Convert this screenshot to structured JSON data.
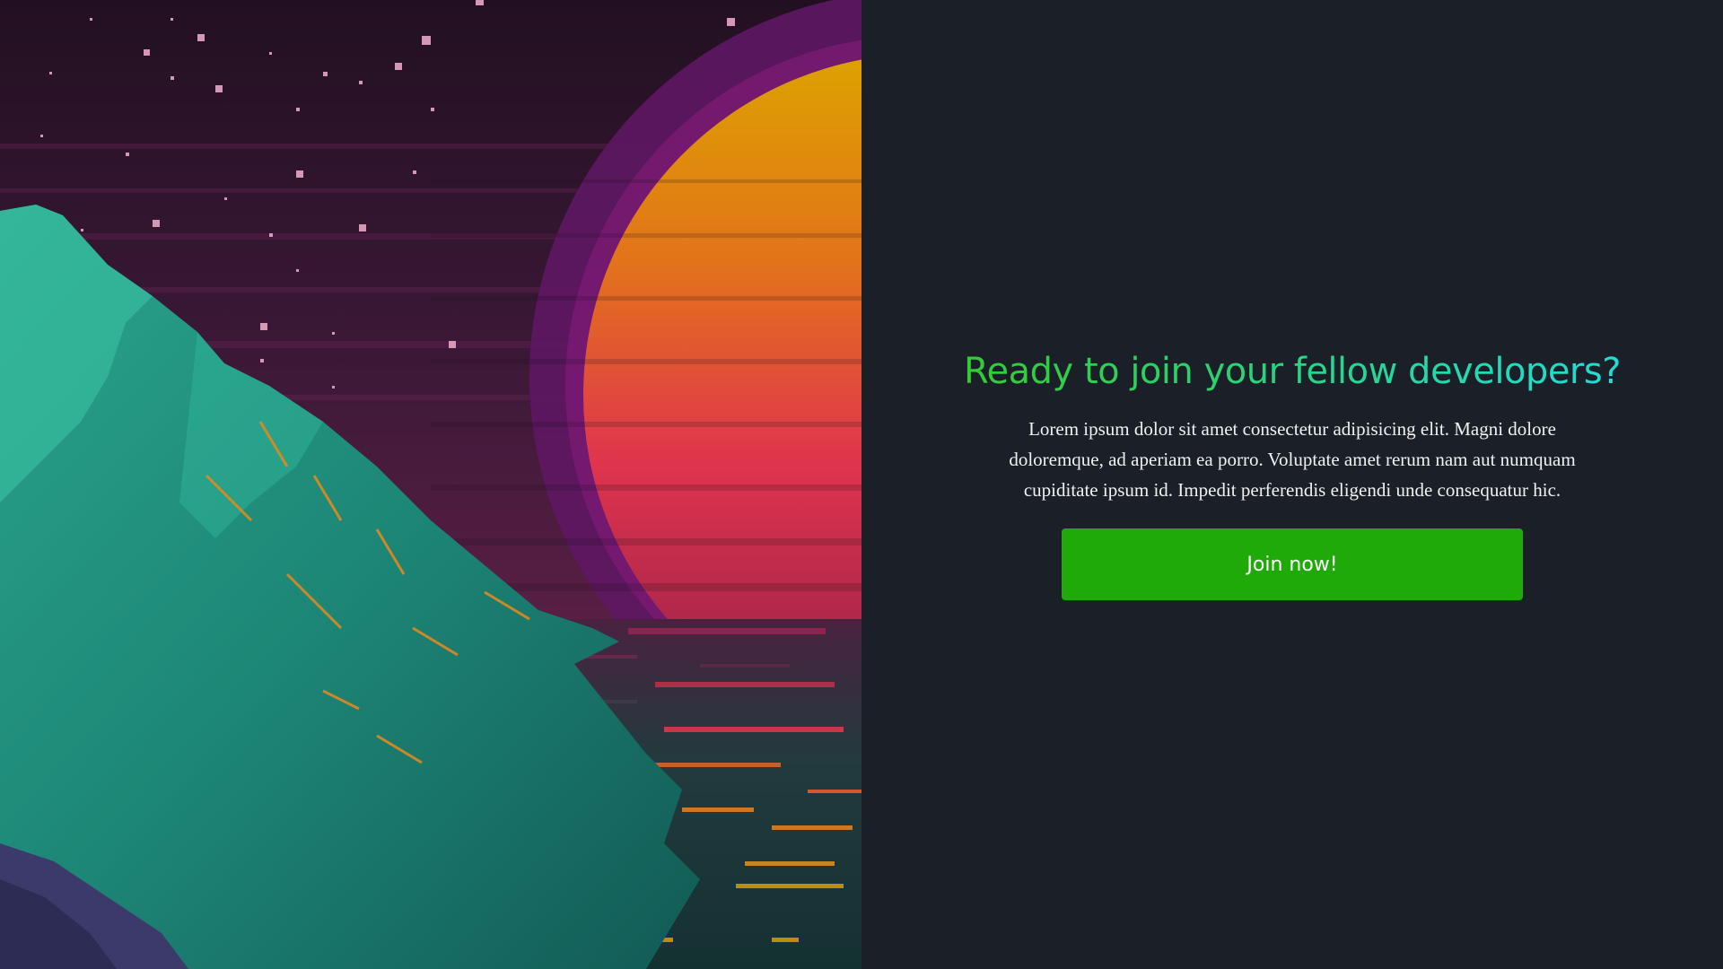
{
  "cta": {
    "title": "Ready to join your fellow developers?",
    "body": "Lorem ipsum dolor sit amet consectetur adipisicing elit. Magni dolore doloremque, ad aperiam ea porro. Voluptate amet rerum nam aut numquam cupiditate ipsum id. Impedit perferendis eligendi unde consequatur hic.",
    "button_label": "Join now!"
  },
  "colors": {
    "panel_background": "#1b1f27",
    "button_green": "#1faa09",
    "title_gradient_start": "#33cc33",
    "title_gradient_end": "#22dcd8"
  },
  "illustration": {
    "subject": "pixel-art sunset over sea with teal mountain and starry purple sky"
  }
}
